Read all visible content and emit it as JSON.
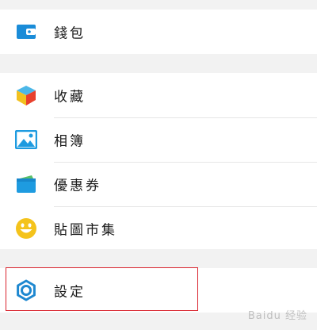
{
  "menu": {
    "wallet": "錢包",
    "favorites": "收藏",
    "albums": "相簿",
    "coupons": "優惠券",
    "sticker_shop": "貼圖市集",
    "settings": "設定"
  },
  "watermark": "Baidu 经验",
  "colors": {
    "wallet_icon": "#1a8cd8",
    "album_icon": "#1e9be0",
    "coupon_icon": "#1e9be0",
    "sticker_icon": "#f4c31c",
    "settings_icon": "#1e88d0",
    "highlight_border": "#d9232d"
  }
}
